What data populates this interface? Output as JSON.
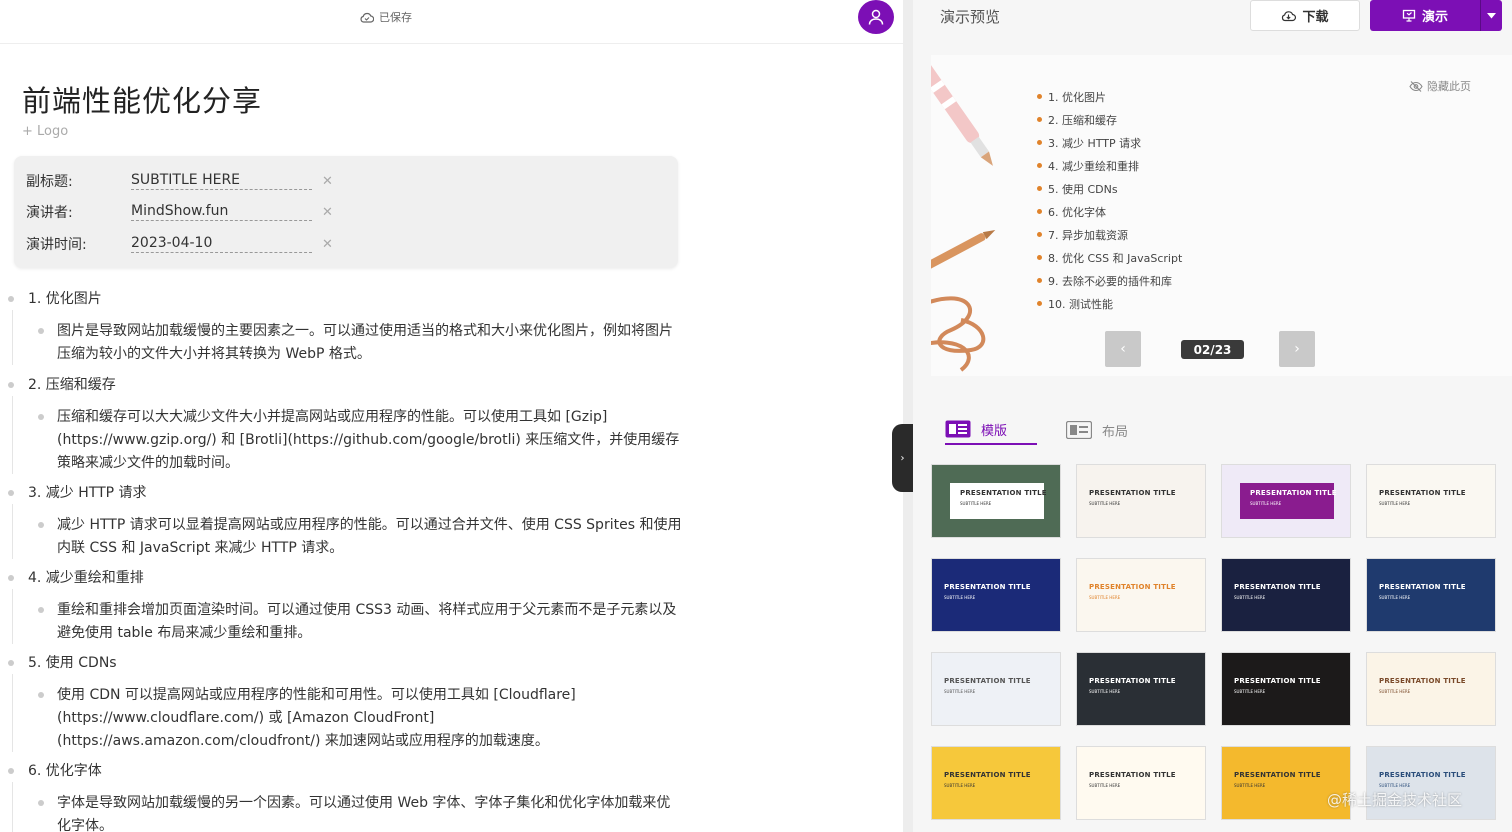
{
  "editor": {
    "saved_label": "已保存",
    "title": "前端性能优化分享",
    "logo_add": "+ Logo",
    "meta": [
      {
        "label": "副标题:",
        "value": "SUBTITLE HERE"
      },
      {
        "label": "演讲者:",
        "value": "MindShow.fun"
      },
      {
        "label": "演讲时间:",
        "value": "2023-04-10"
      }
    ],
    "outline": [
      {
        "heading": "1. 优化图片",
        "body": "图片是导致网站加载缓慢的主要因素之一。可以通过使用适当的格式和大小来优化图片，例如将图片压缩为较小的文件大小并将其转换为 WebP 格式。"
      },
      {
        "heading": "2. 压缩和缓存",
        "body": "压缩和缓存可以大大减少文件大小并提高网站或应用程序的性能。可以使用工具如 [Gzip](https://www.gzip.org/) 和 [Brotli](https://github.com/google/brotli) 来压缩文件，并使用缓存策略来减少文件的加载时间。"
      },
      {
        "heading": "3. 减少 HTTP 请求",
        "body": "减少 HTTP 请求可以显着提高网站或应用程序的性能。可以通过合并文件、使用 CSS Sprites 和使用内联 CSS 和 JavaScript 来减少 HTTP 请求。"
      },
      {
        "heading": "4. 减少重绘和重排",
        "body": "重绘和重排会增加页面渲染时间。可以通过使用 CSS3 动画、将样式应用于父元素而不是子元素以及避免使用 table 布局来减少重绘和重排。"
      },
      {
        "heading": "5. 使用 CDNs",
        "body": "使用 CDN 可以提高网站或应用程序的性能和可用性。可以使用工具如 [Cloudflare](https://www.cloudflare.com/) 或 [Amazon CloudFront](https://aws.amazon.com/cloudfront/) 来加速网站或应用程序的加载速度。"
      },
      {
        "heading": "6. 优化字体",
        "body": "字体是导致网站加载缓慢的另一个因素。可以通过使用 Web 字体、字体子集化和优化字体加载来优化字体。"
      }
    ]
  },
  "preview": {
    "title": "演示预览",
    "download_label": "下载",
    "present_label": "演示",
    "hide_page_label": "隐藏此页",
    "slide_items": [
      "1. 优化图片",
      "2. 压缩和缓存",
      "3. 减少 HTTP 请求",
      "4. 减少重绘和重排",
      "5. 使用 CDNs",
      "6. 优化字体",
      "7. 异步加载资源",
      "8. 优化 CSS 和 JavaScript",
      "9. 去除不必要的插件和库",
      "10. 测试性能"
    ],
    "page_indicator": "02/23",
    "prev_glyph": "‹",
    "next_glyph": "›",
    "tabs": {
      "template": "模版",
      "layout": "布局"
    },
    "templates": [
      {
        "title": "PRESENTATION TITLE",
        "subtitle": "SUBTITLE HERE",
        "bg": "#4f6b55",
        "fg": "#333",
        "box": "#ffffff"
      },
      {
        "title": "PRESENTATION TITLE",
        "subtitle": "SUBTITLE HERE",
        "bg": "#f7f3ee",
        "fg": "#333",
        "box": ""
      },
      {
        "title": "PRESENTATION TITLE",
        "subtitle": "SUBTITLE HERE",
        "bg": "#efeaf7",
        "fg": "#ffffff",
        "box": "#8a1c8f"
      },
      {
        "title": "PRESENTATION TITLE",
        "subtitle": "SUBTITLE HERE",
        "bg": "#faf8f2",
        "fg": "#333",
        "box": ""
      },
      {
        "title": "PRESENTATION TITLE",
        "subtitle": "SUBTITLE HERE",
        "bg": "#1b2a78",
        "fg": "#ffffff",
        "box": ""
      },
      {
        "title": "PRESENTATION TITLE",
        "subtitle": "SUBTITLE HERE",
        "bg": "#fbf7ef",
        "fg": "#e0832b",
        "box": ""
      },
      {
        "title": "PRESENTATION TITLE",
        "subtitle": "SUBTITLE HERE",
        "bg": "#1a2140",
        "fg": "#ffffff",
        "box": ""
      },
      {
        "title": "PRESENTATION TITLE",
        "subtitle": "SUBTITLE HERE",
        "bg": "#1f3a6e",
        "fg": "#ffffff",
        "box": ""
      },
      {
        "title": "PRESENTATION TITLE",
        "subtitle": "SUBTITLE HERE",
        "bg": "#eef1f6",
        "fg": "#555",
        "box": ""
      },
      {
        "title": "PRESENTATION TITLE",
        "subtitle": "SUBTITLE HERE",
        "bg": "#2a2f35",
        "fg": "#ffffff",
        "box": ""
      },
      {
        "title": "PRESENTATION TITLE",
        "subtitle": "SUBTITLE HERE",
        "bg": "#1c1a1a",
        "fg": "#ffffff",
        "box": ""
      },
      {
        "title": "PRESENTATION TITLE",
        "subtitle": "SUBTITLE HERE",
        "bg": "#fbf4e7",
        "fg": "#7a4a2a",
        "box": ""
      },
      {
        "title": "PRESENTATION TITLE",
        "subtitle": "SUBTITLE HERE",
        "bg": "#f6c83b",
        "fg": "#333",
        "box": ""
      },
      {
        "title": "PRESENTATION TITLE",
        "subtitle": "SUBTITLE HERE",
        "bg": "#fffaf0",
        "fg": "#333",
        "box": ""
      },
      {
        "title": "PRESENTATION TITLE",
        "subtitle": "SUBTITLE HERE",
        "bg": "#f4b92d",
        "fg": "#333",
        "box": ""
      },
      {
        "title": "PRESENTATION TITLE",
        "subtitle": "SUBTITLE HERE",
        "bg": "#dde3ea",
        "fg": "#2a4d7a",
        "box": ""
      }
    ]
  },
  "watermark": "@稀土掘金技术社区",
  "colors": {
    "accent": "#7c0fb5",
    "bullet": "#e0832b"
  }
}
